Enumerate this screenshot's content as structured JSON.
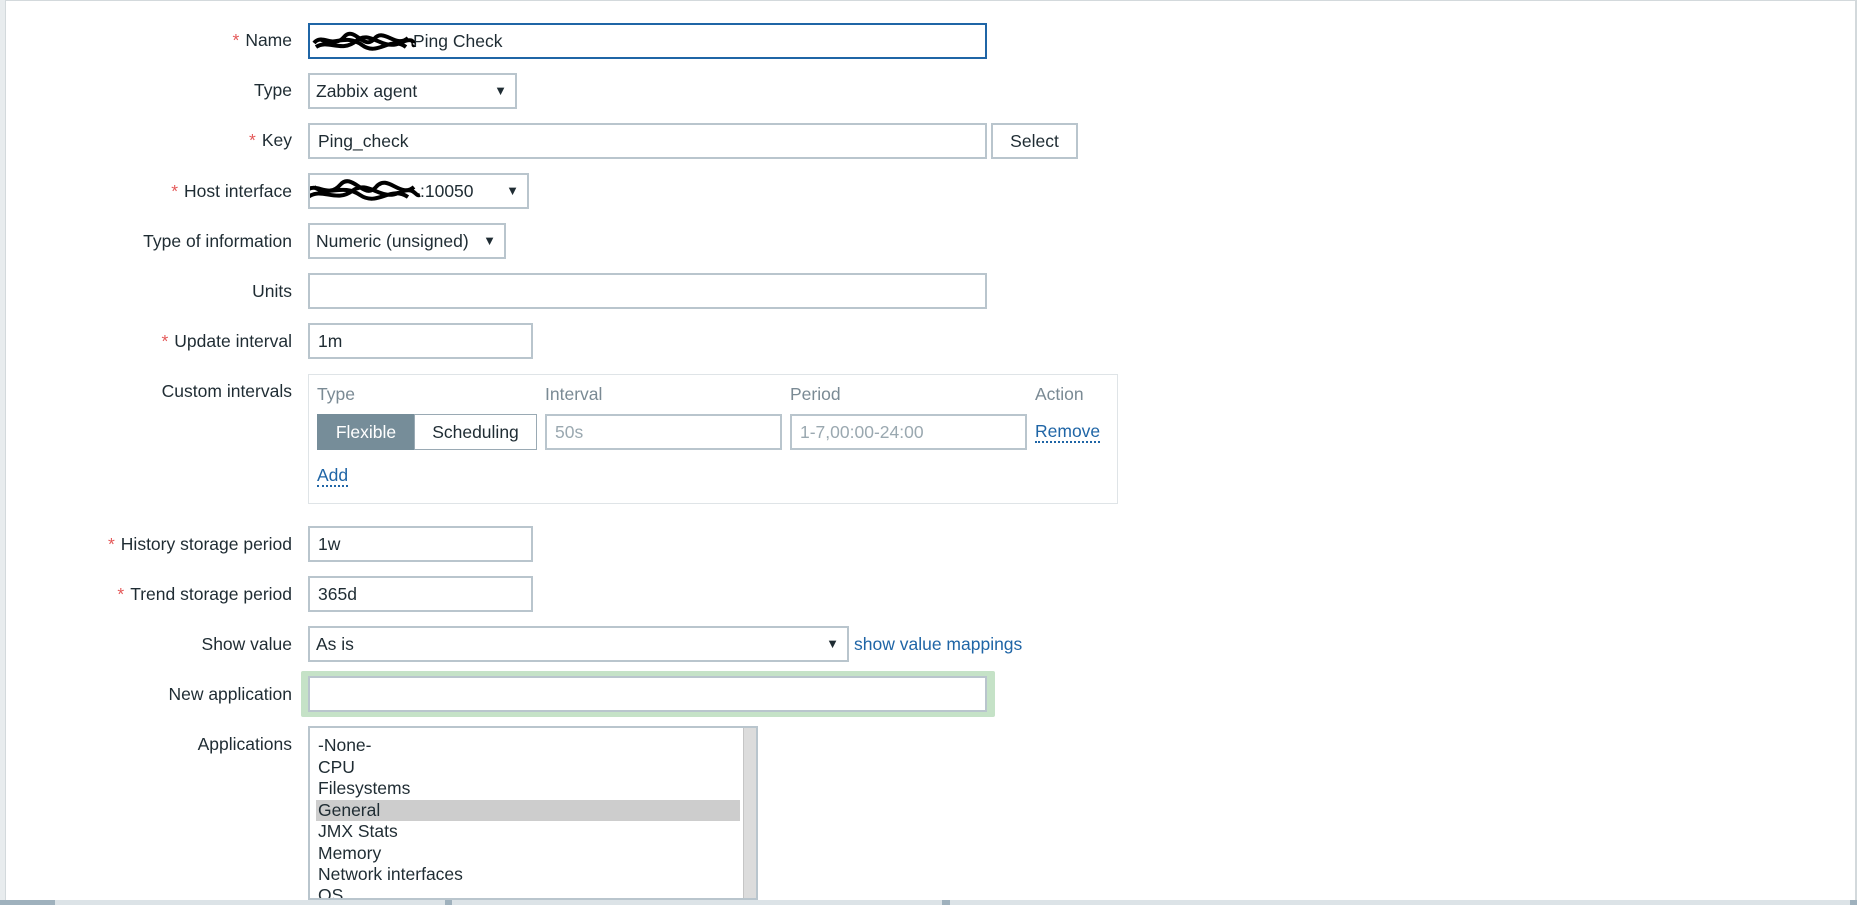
{
  "form": {
    "name": {
      "label": "Name",
      "value": "Ping Check"
    },
    "type": {
      "label": "Type",
      "value": "Zabbix agent"
    },
    "key": {
      "label": "Key",
      "value": "Ping_check",
      "select_label": "Select"
    },
    "host_interface": {
      "label": "Host interface",
      "value": ":10050"
    },
    "type_of_information": {
      "label": "Type of information",
      "value": "Numeric (unsigned)"
    },
    "units": {
      "label": "Units",
      "value": ""
    },
    "update_interval": {
      "label": "Update interval",
      "value": "1m"
    },
    "custom_intervals": {
      "label": "Custom intervals",
      "headers": [
        "Type",
        "Interval",
        "Period",
        "Action"
      ],
      "row": {
        "type_options": [
          "Flexible",
          "Scheduling"
        ],
        "active_type": "Flexible",
        "interval_placeholder": "50s",
        "period_placeholder": "1-7,00:00-24:00",
        "remove_label": "Remove"
      },
      "add_label": "Add"
    },
    "history": {
      "label": "History storage period",
      "value": "1w"
    },
    "trend": {
      "label": "Trend storage period",
      "value": "365d"
    },
    "show_value": {
      "label": "Show value",
      "value": "As is",
      "mappings_link": "show value mappings"
    },
    "new_application": {
      "label": "New application",
      "value": ""
    },
    "applications": {
      "label": "Applications",
      "options": [
        "-None-",
        "CPU",
        "Filesystems",
        "General",
        "JMX Stats",
        "Memory",
        "Network interfaces",
        "OS"
      ],
      "selected": "General"
    }
  },
  "colors": {
    "required_marker": "#e45959",
    "link": "#1f65a6",
    "focus_border": "#1f65a6",
    "active_segment": "#768d99",
    "new_app_highlight": "#c5e2c7"
  },
  "icons": {
    "dropdown": "triangle-down-icon"
  }
}
